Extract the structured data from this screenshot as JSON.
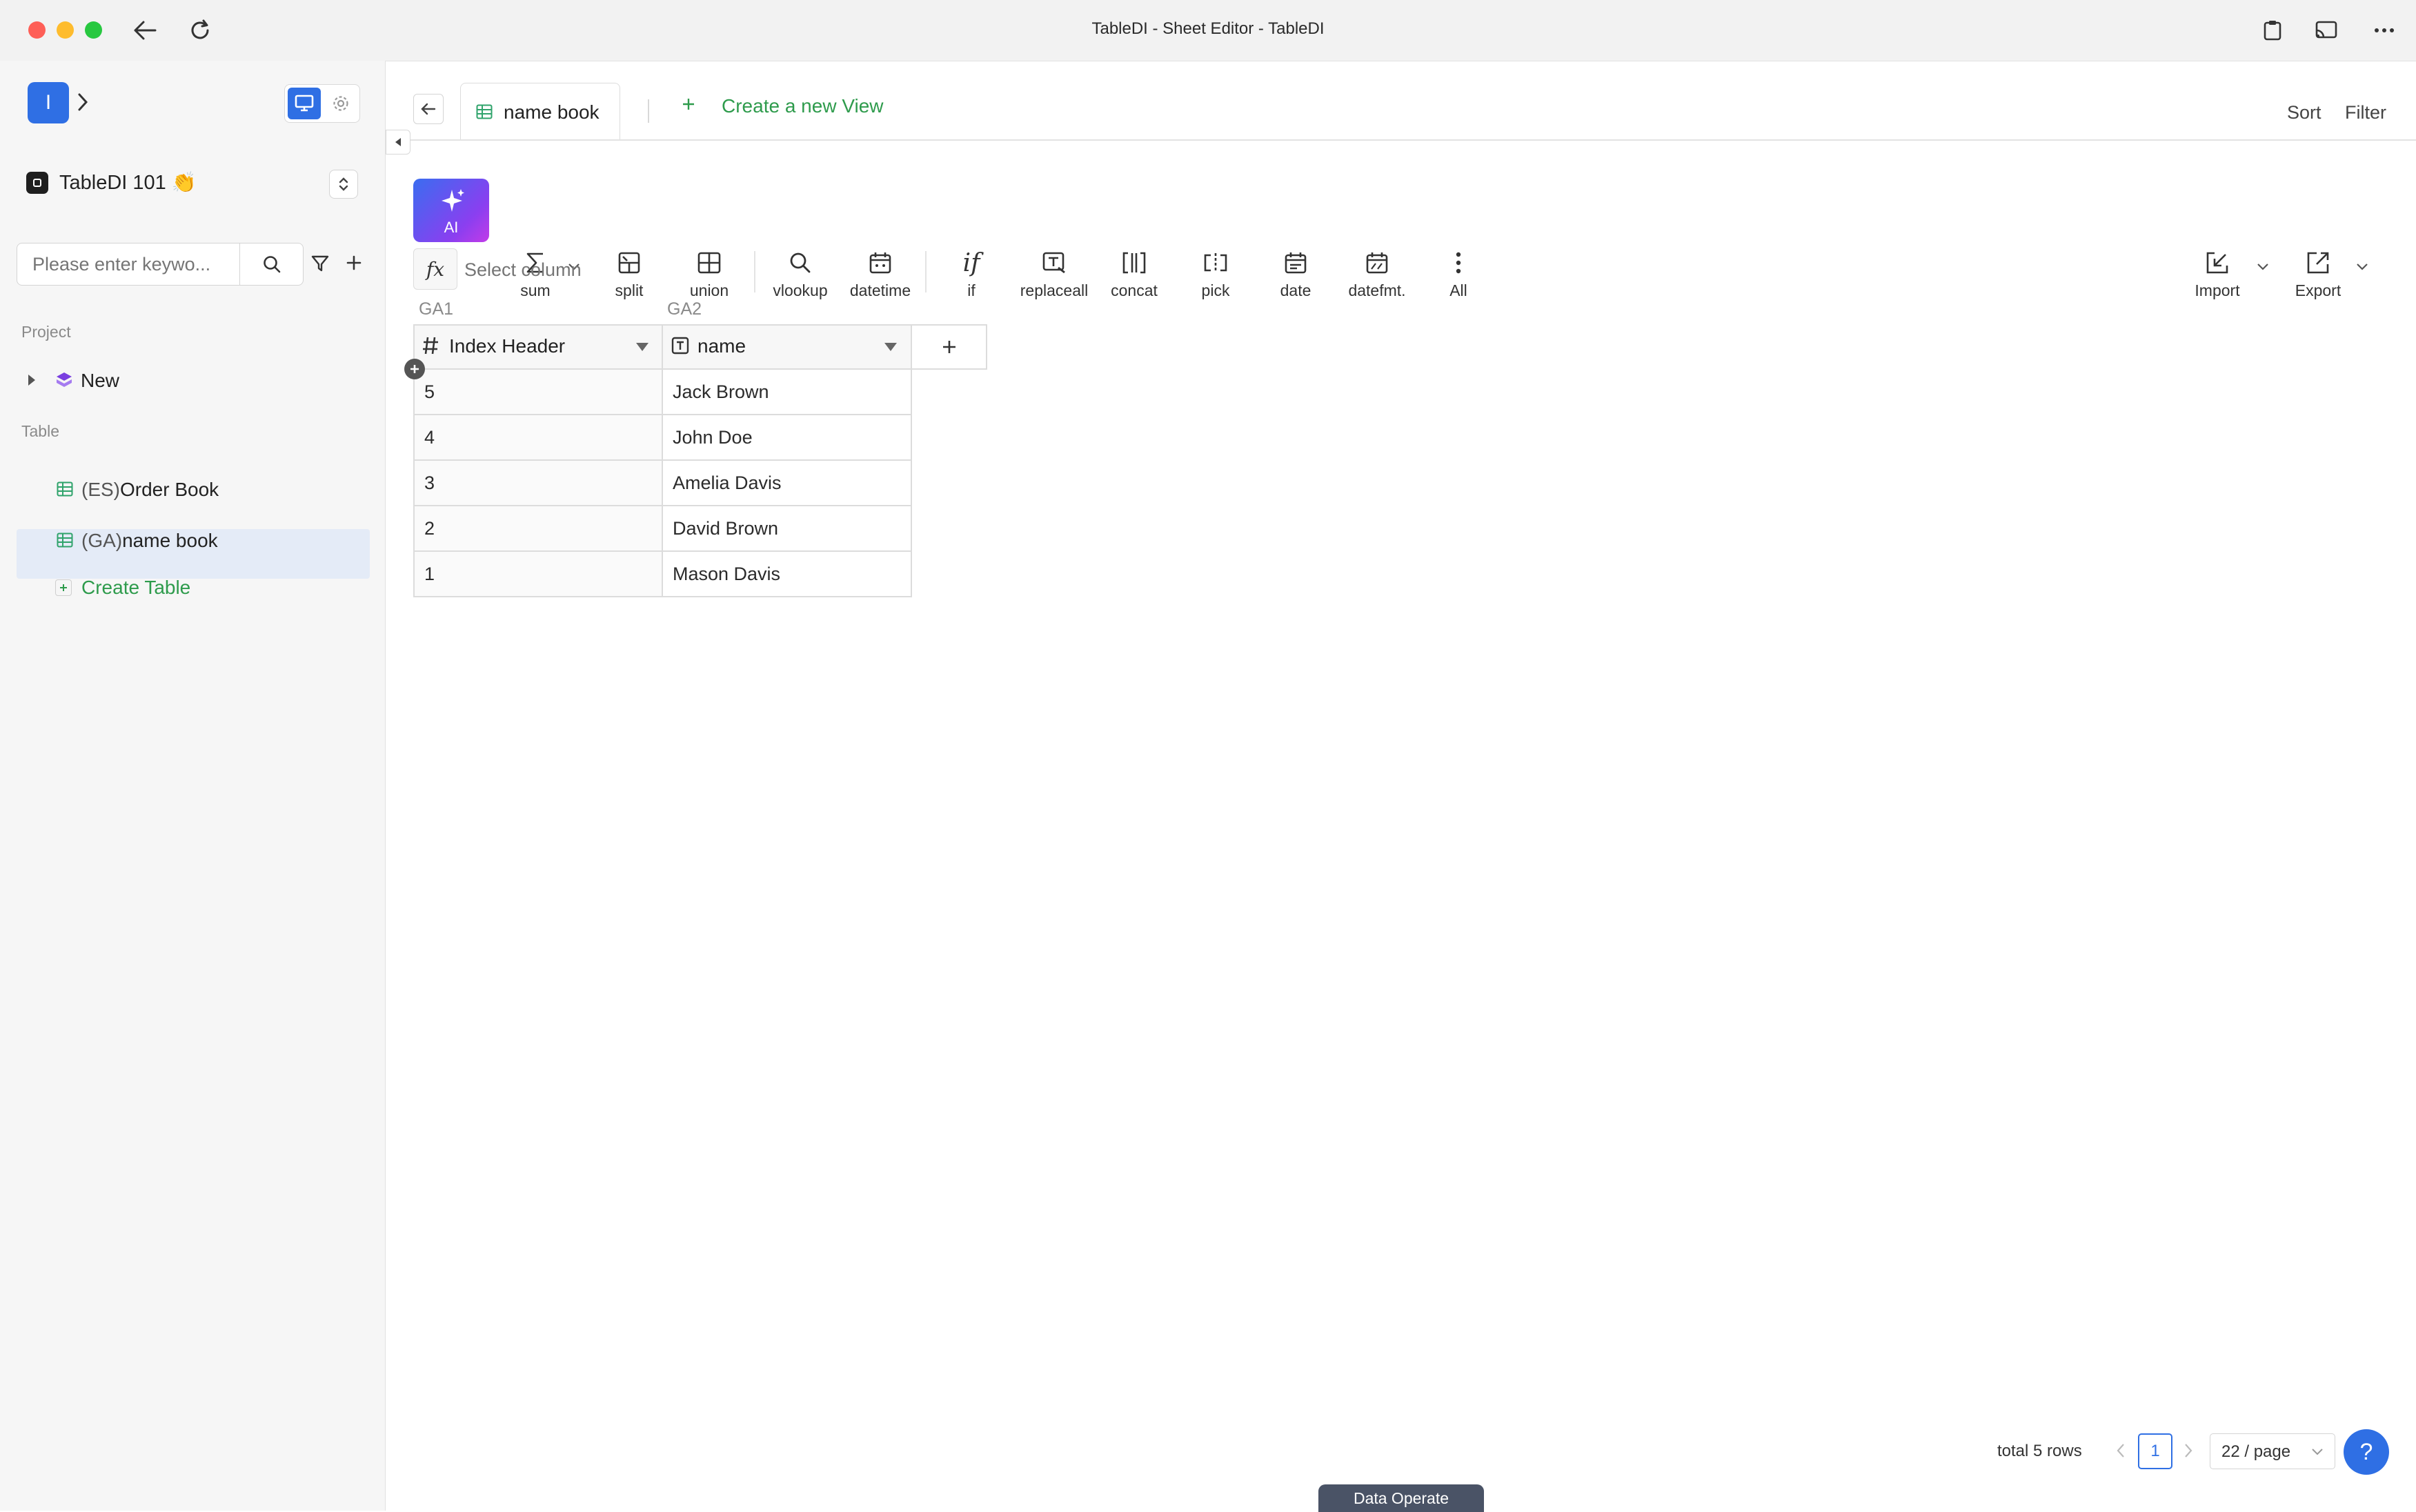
{
  "window": {
    "title": "TableDI - Sheet Editor - TableDI"
  },
  "sidebar": {
    "workspace_initial": "I",
    "workspace_name": "TableDI 101 👏",
    "search_placeholder": "Please enter keywo...",
    "project_section": "Project",
    "project_item": "New",
    "table_section": "Table",
    "tables": [
      {
        "prefix": "(ES)",
        "name": "Order Book"
      },
      {
        "prefix": "(GA)",
        "name": "name book"
      }
    ],
    "create_table_label": "Create Table"
  },
  "tabs": {
    "active_tab": "name book",
    "create_view_label": "Create a new View",
    "sort_label": "Sort",
    "filter_label": "Filter"
  },
  "toolbar": {
    "ai_label": "AI",
    "tools": [
      "sum",
      "split",
      "union",
      "vlookup",
      "datetime",
      "if",
      "replaceall",
      "concat",
      "pick",
      "date",
      "datefmt.",
      "All"
    ],
    "import_label": "Import",
    "export_label": "Export"
  },
  "formula_bar": {
    "fx": "fx",
    "placeholder": "Select column"
  },
  "table": {
    "column_ids": [
      "GA1",
      "GA2"
    ],
    "headers": [
      "Index Header",
      "name"
    ],
    "rows": [
      [
        "5",
        "Jack Brown"
      ],
      [
        "4",
        "John Doe"
      ],
      [
        "3",
        "Amelia Davis"
      ],
      [
        "2",
        "David Brown"
      ],
      [
        "1",
        "Mason Davis"
      ]
    ]
  },
  "pagination": {
    "total_text": "total 5 rows",
    "current_page": "1",
    "page_size": "22 / page"
  },
  "bottom_tab": "Data Operate",
  "help_label": "?",
  "colors": {
    "accent_blue": "#2f6fe4",
    "green_link": "#2e9b4c",
    "selected_row": "#e4ebf7"
  }
}
